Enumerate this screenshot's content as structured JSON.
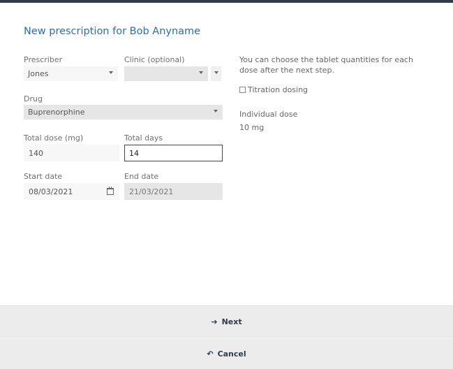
{
  "title": "New prescription for Bob Anyname",
  "prescriber": {
    "label": "Prescriber",
    "value": "Jones"
  },
  "clinic": {
    "label": "Clinic (optional)",
    "value": ""
  },
  "drug": {
    "label": "Drug",
    "value": "Buprenorphine"
  },
  "total_dose": {
    "label": "Total dose (mg)",
    "value": "140"
  },
  "total_days": {
    "label": "Total days",
    "value": "14"
  },
  "start_date": {
    "label": "Start date",
    "value": "08/03/2021"
  },
  "end_date": {
    "label": "End date",
    "value": "21/03/2021"
  },
  "info_text": "You can choose the tablet quantities for each dose after the next step.",
  "titration": {
    "label": "Titration dosing",
    "checked": false
  },
  "individual_dose": {
    "label": "Individual dose",
    "value": "10 mg"
  },
  "buttons": {
    "next": "Next",
    "cancel": "Cancel"
  },
  "icons": {
    "next": "arrow-right-icon",
    "cancel": "undo-icon",
    "calendar": "calendar-icon"
  }
}
